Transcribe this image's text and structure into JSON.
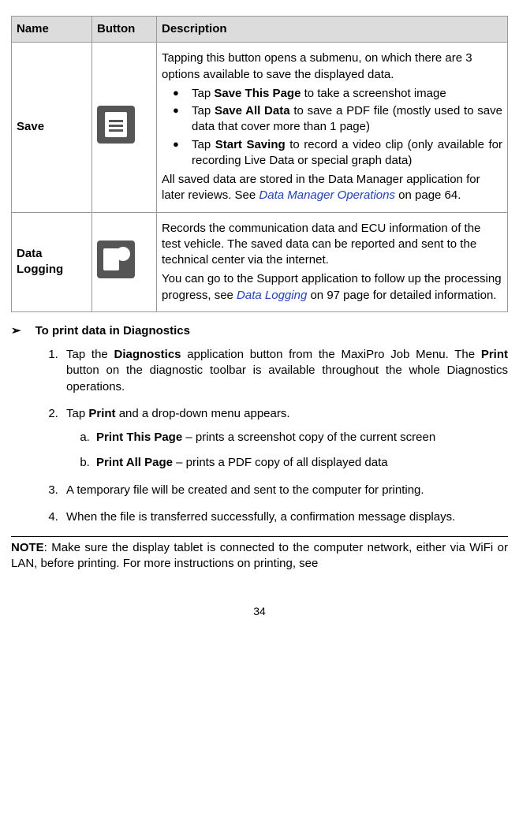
{
  "table": {
    "headers": {
      "name": "Name",
      "button": "Button",
      "desc": "Description"
    },
    "rows": [
      {
        "name": "Save",
        "intro": "Tapping this button opens a submenu, on which there are 3 options available to save the displayed data.",
        "b1_bold": "Save This Page",
        "b1_rest": " to take a screenshot image",
        "b2_bold": "Save All Data",
        "b2_rest": " to save a PDF file (mostly used to save data that cover more than 1 page)",
        "b3_bold": "Start Saving",
        "b3_rest": " to record a video clip (only available for recording Live Data or special graph data)",
        "outro_a": "All saved data are stored in the Data Manager application for later reviews. See ",
        "outro_link": "Data Manager Operations",
        "outro_b": " on page 64."
      },
      {
        "name": "Data Logging",
        "p1": "Records the communication data and ECU information of the test vehicle. The saved data can be reported and sent to the technical center via the internet.",
        "p2_a": "You can go to the Support application to follow up the processing progress, see ",
        "p2_link": "Data Logging",
        "p2_b": " on 97 page for detailed information."
      }
    ]
  },
  "section_title": "To print data in Diagnostics",
  "steps": {
    "s1_a": "Tap the ",
    "s1_bold": "Diagnostics",
    "s1_b": " application button from the MaxiPro Job Menu. The ",
    "s1_bold2": "Print",
    "s1_c": " button on the diagnostic toolbar is available throughout the whole Diagnostics operations.",
    "s2_a": "Tap ",
    "s2_bold": "Print",
    "s2_b": " and a drop-down menu appears.",
    "sa_bold": "Print This Page",
    "sa_rest": " – prints a screenshot copy of the current screen",
    "sb_bold": "Print All Page",
    "sb_rest": " – prints a PDF copy of all displayed data",
    "s3": "A temporary file will be created and sent to the computer for printing.",
    "s4": "When the file is transferred successfully, a confirmation message displays."
  },
  "note_label": "NOTE",
  "note_text": ": Make sure the display tablet is connected to the computer network, either via WiFi or LAN, before printing. For more instructions on printing, see",
  "page_number": "34"
}
